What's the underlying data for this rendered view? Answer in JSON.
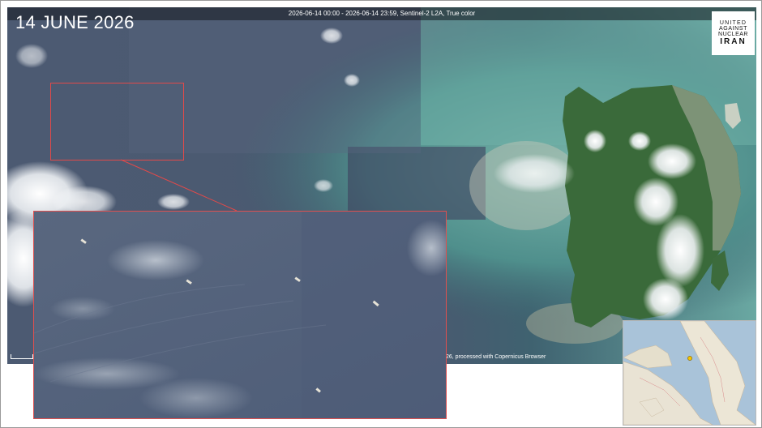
{
  "image": {
    "date_title": "14 JUNE 2026",
    "header_info": "2026-06-14 00:00 - 2026-06-14 23:59, Sentinel-2 L2A, True color",
    "credit_text": "26, processed with Copernicus Browser"
  },
  "logo": {
    "line1": "UNITED",
    "line2": "AGAINST",
    "line3": "NUCLEAR",
    "line4": "IRAN"
  },
  "colors": {
    "inset_border": "#e04a4a",
    "water": "#4f5e76",
    "shallow_water": "#5f9e98",
    "land": "#3a6a3a"
  },
  "icons": {
    "map_marker": "map-marker-icon"
  }
}
